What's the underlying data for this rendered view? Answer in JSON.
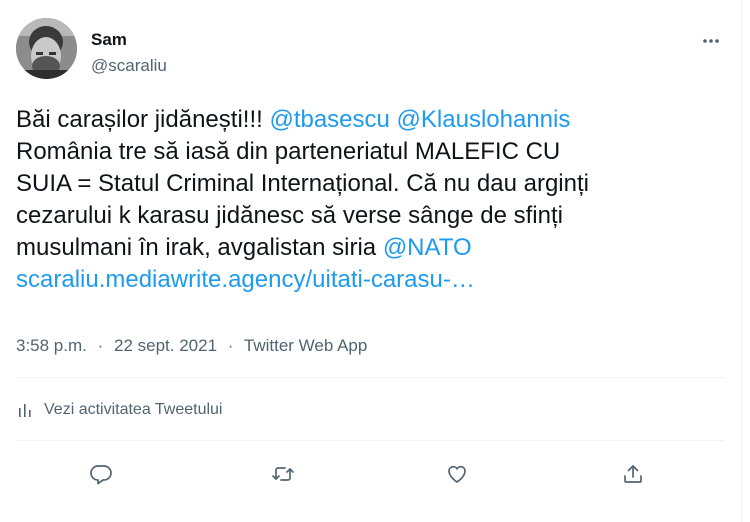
{
  "author": {
    "name": "Sam",
    "handle": "@scaraliu"
  },
  "tweet": {
    "segments": [
      {
        "text": "Băi carașilor jidănești!!! ",
        "type": "text"
      },
      {
        "text": "@tbasescu",
        "type": "link"
      },
      {
        "text": " ",
        "type": "text"
      },
      {
        "text": "@Klauslohannis",
        "type": "link"
      },
      {
        "text": "\nRomânia tre să iasă din parteneriatul MALEFIC CU\nSUIA = Statul Criminal Internațional. Că nu dau arginți\ncezarului k karasu jidănesc să verse sânge de sfinți\nmusulmani în irak, avgalistan siria ",
        "type": "text"
      },
      {
        "text": "@NATO",
        "type": "link"
      },
      {
        "text": "\n",
        "type": "text"
      },
      {
        "text": "scaraliu.mediawrite.agency/uitati-carasu-…",
        "type": "link"
      }
    ]
  },
  "meta": {
    "time": "3:58 p.m.",
    "date": "22 sept. 2021",
    "source": "Twitter Web App",
    "separator": "·"
  },
  "activity_label": "Vezi activitatea Tweetului",
  "icons": {
    "more": "more-icon",
    "activity": "activity-chart-icon",
    "reply": "reply-icon",
    "retweet": "retweet-icon",
    "like": "like-icon",
    "share": "share-icon"
  },
  "colors": {
    "link": "#1d9bf0",
    "secondary_text": "#536471",
    "primary_text": "#0f1419",
    "divider": "#eff3f4"
  }
}
